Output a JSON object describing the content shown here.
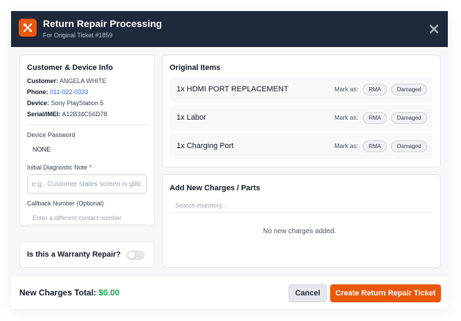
{
  "header": {
    "title": "Return Repair Processing",
    "subtitle": "For Original Ticket #1859"
  },
  "customer_card": {
    "title": "Customer & Device Info",
    "customer_label": "Customer:",
    "customer_value": "ANGELA WHITE",
    "phone_label": "Phone:",
    "phone_value": "011-022-0333",
    "device_label": "Device:",
    "device_value": "Sony PlayStation 5",
    "serial_label": "Serial/IMEI:",
    "serial_value": "A12B34C56D78",
    "password_label": "Device Password",
    "password_value": "NONE",
    "diagnostic_label": "Initial Diagnostic Note",
    "diagnostic_required": "*",
    "diagnostic_value": "",
    "diagnostic_placeholder": "e.g., Customer states screen is glitching again",
    "callback_label": "Callback Number (Optional)",
    "callback_value": "",
    "callback_placeholder": "Enter a different contact number"
  },
  "warranty": {
    "label": "Is this a Warranty Repair?",
    "enabled": false
  },
  "original_items": {
    "title": "Original Items",
    "mark_as_label": "Mark as:",
    "rma_label": "RMA",
    "damaged_label": "Damaged",
    "items": [
      {
        "name": "1x HDMI PORT REPLACEMENT"
      },
      {
        "name": "1x Labor"
      },
      {
        "name": "1x Charging Port"
      }
    ]
  },
  "new_charges": {
    "title": "Add New Charges / Parts",
    "search_value": "",
    "search_placeholder": "Search inventory...",
    "empty_message": "No new charges added."
  },
  "footer": {
    "total_label": "New Charges Total:",
    "total_value": "$0.00",
    "cancel_label": "Cancel",
    "create_label": "Create Return Repair Ticket"
  },
  "colors": {
    "header_bg": "#1e293b",
    "accent": "#ea580c",
    "link": "#2563eb",
    "total_green": "#16a34a"
  },
  "icons": {
    "app": "tools-icon",
    "close": "close-icon"
  }
}
